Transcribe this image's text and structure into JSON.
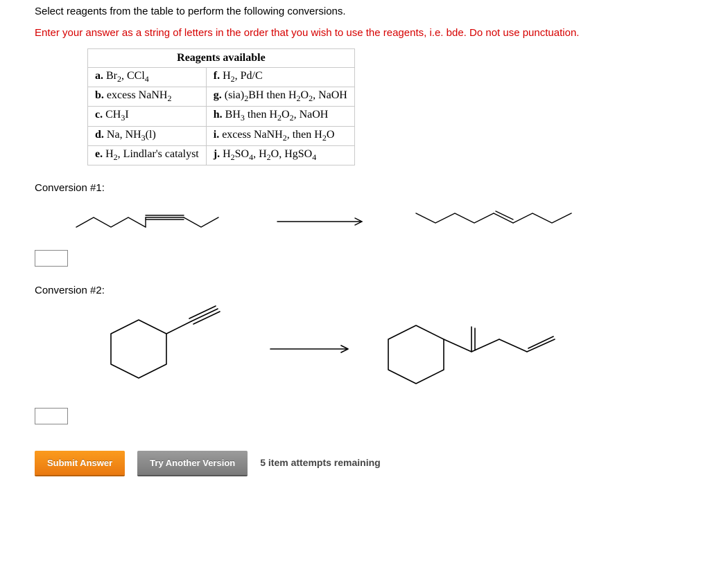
{
  "instruction1": "Select reagents from the table to perform the following conversions.",
  "instruction2": "Enter your answer as a string of letters in the order that you wish to use the reagents, i.e. bde. Do not use punctuation.",
  "table": {
    "header": "Reagents available",
    "rows": [
      {
        "left_label": "a.",
        "left_html": "Br<sub>2</sub>, CCl<sub>4</sub>",
        "right_label": "f.",
        "right_html": "H<sub>2</sub>, Pd/C"
      },
      {
        "left_label": "b.",
        "left_html": "excess NaNH<sub>2</sub>",
        "right_label": "g.",
        "right_html": "(sia)<sub>2</sub>BH then H<sub>2</sub>O<sub>2</sub>, NaOH"
      },
      {
        "left_label": "c.",
        "left_html": "CH<sub>3</sub>I",
        "right_label": "h.",
        "right_html": "BH<sub>3</sub> then H<sub>2</sub>O<sub>2</sub>, NaOH"
      },
      {
        "left_label": "d.",
        "left_html": "Na, NH<sub>3</sub>(l)",
        "right_label": "i.",
        "right_html": "excess NaNH<sub>2</sub>, then H<sub>2</sub>O"
      },
      {
        "left_label": "e.",
        "left_html": "H<sub>2</sub>, Lindlar's catalyst",
        "right_label": "j.",
        "right_html": "H<sub>2</sub>SO<sub>4</sub>, H<sub>2</sub>O, HgSO<sub>4</sub>"
      }
    ]
  },
  "conv1_label": "Conversion #1:",
  "conv2_label": "Conversion #2:",
  "buttons": {
    "submit": "Submit Answer",
    "try": "Try Another Version"
  },
  "attempts": "5 item attempts remaining"
}
